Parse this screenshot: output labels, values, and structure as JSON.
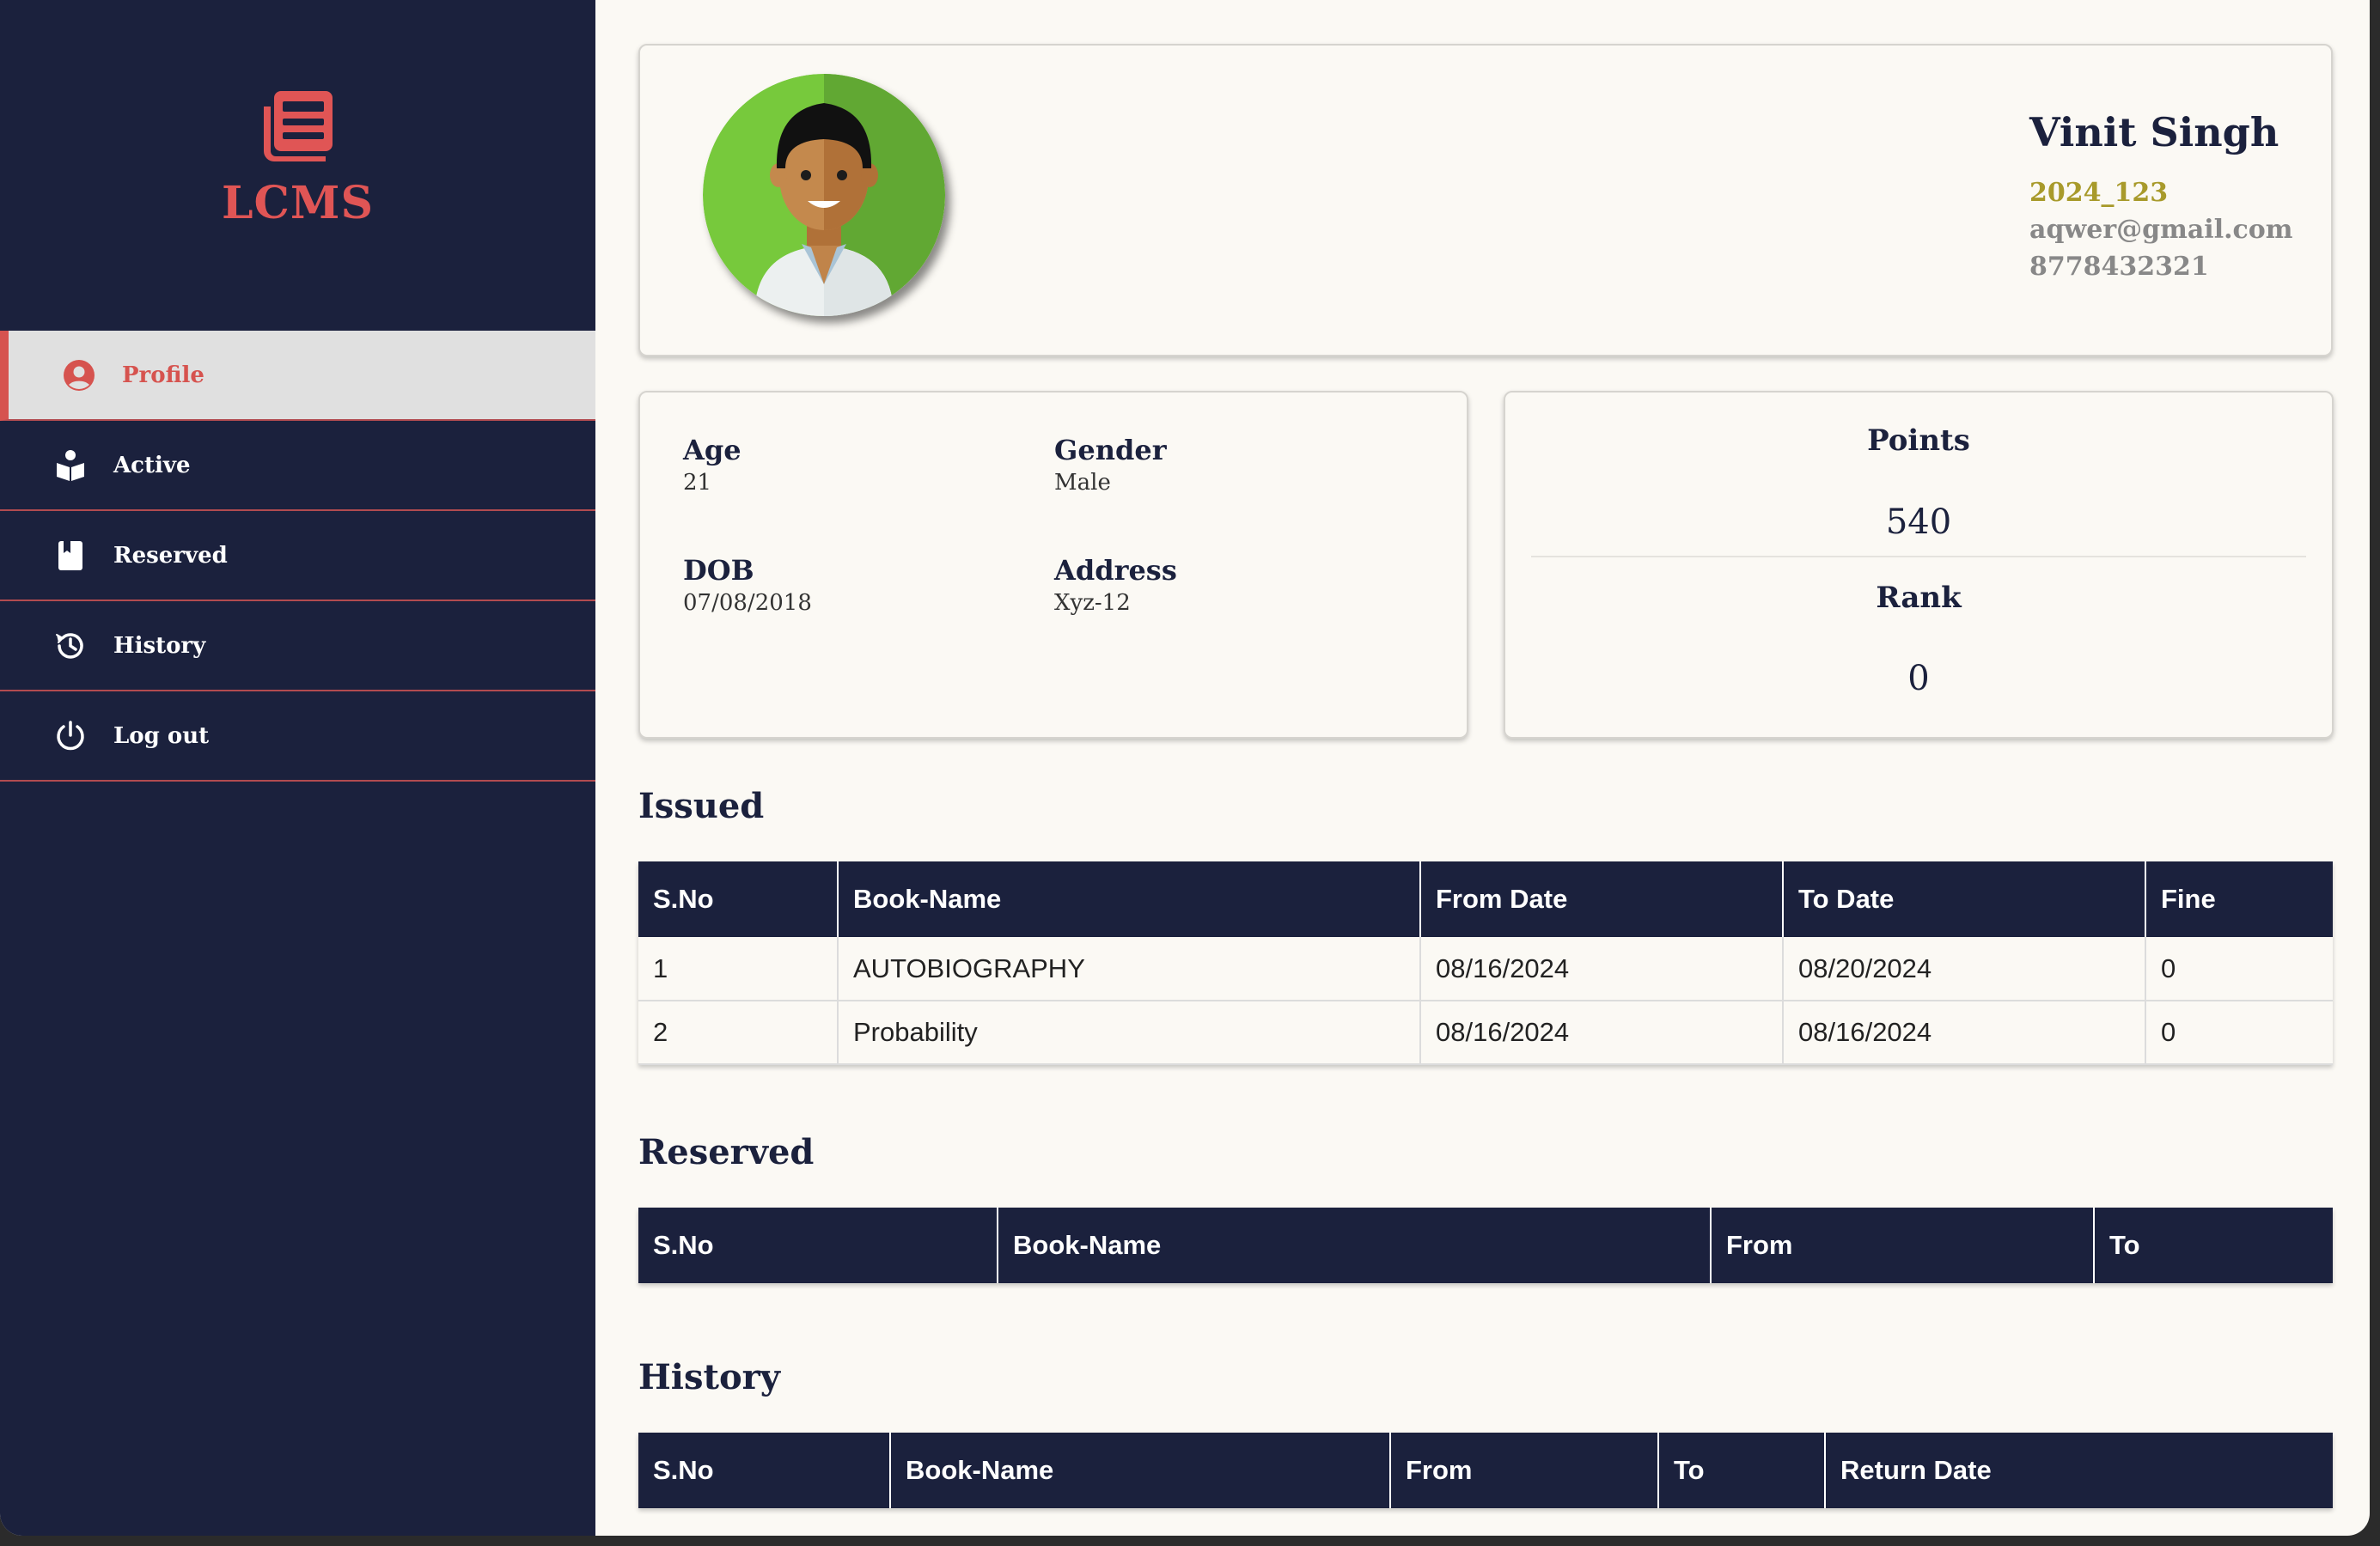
{
  "app": {
    "name": "LCMS",
    "brand_color": "#e05555",
    "sidebar_color": "#1b213d"
  },
  "nav": {
    "items": [
      {
        "label": "Profile",
        "icon": "user-circle-icon",
        "active": true
      },
      {
        "label": "Active",
        "icon": "book-reader-icon",
        "active": false
      },
      {
        "label": "Reserved",
        "icon": "bookmark-book-icon",
        "active": false
      },
      {
        "label": "History",
        "icon": "history-icon",
        "active": false
      },
      {
        "label": "Log out",
        "icon": "power-icon",
        "active": false
      }
    ]
  },
  "profile": {
    "name": "Vinit Singh",
    "id": "2024_123",
    "email": "aqwer@gmail.com",
    "phone": "8778432321"
  },
  "details": {
    "age_label": "Age",
    "age": "21",
    "gender_label": "Gender",
    "gender": "Male",
    "dob_label": "DOB",
    "dob": "07/08/2018",
    "address_label": "Address",
    "address": "Xyz-12"
  },
  "stats": {
    "points_label": "Points",
    "points": "540",
    "rank_label": "Rank",
    "rank": "0"
  },
  "issued": {
    "title": "Issued",
    "headers": [
      "S.No",
      "Book-Name",
      "From Date",
      "To Date",
      "Fine"
    ],
    "rows": [
      [
        "1",
        "AUTOBIOGRAPHY",
        "08/16/2024",
        "08/20/2024",
        "0"
      ],
      [
        "2",
        "Probability",
        "08/16/2024",
        "08/16/2024",
        "0"
      ]
    ]
  },
  "reserved": {
    "title": "Reserved",
    "headers": [
      "S.No",
      "Book-Name",
      "From",
      "To"
    ]
  },
  "history": {
    "title": "History",
    "headers": [
      "S.No",
      "Book-Name",
      "From",
      "To",
      "Return Date"
    ]
  }
}
